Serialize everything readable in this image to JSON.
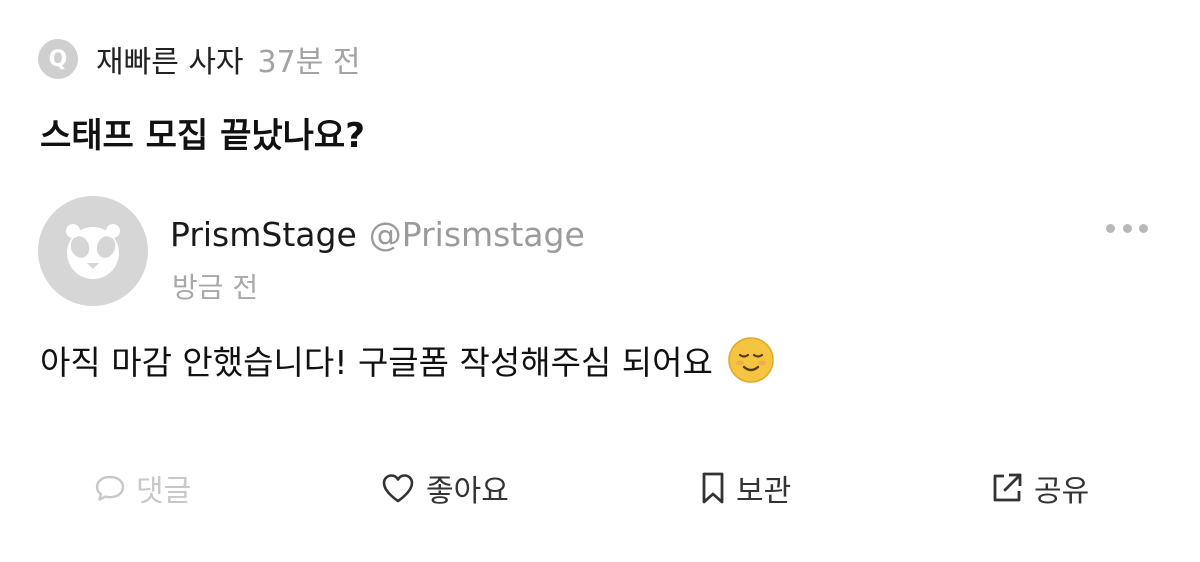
{
  "question": {
    "badge": "Q",
    "author": "재빠른 사자",
    "time": "37분 전",
    "title": "스태프 모집 끝났나요?"
  },
  "answer": {
    "name": "PrismStage",
    "handle": "@Prismstage",
    "time": "방금 전",
    "body": "아직 마감 안했습니다! 구글폼 작성해주심 되어요",
    "avatar_icon": "panda-avatar-icon",
    "emoji_icon": "smiling-face-icon"
  },
  "actions": {
    "comment": "댓글",
    "like": "좋아요",
    "save": "보관",
    "share": "공유"
  },
  "colors": {
    "muted": "#a3a3a3",
    "disabled": "#c8c8c8",
    "text": "#111111",
    "emoji": "#f5c542"
  }
}
